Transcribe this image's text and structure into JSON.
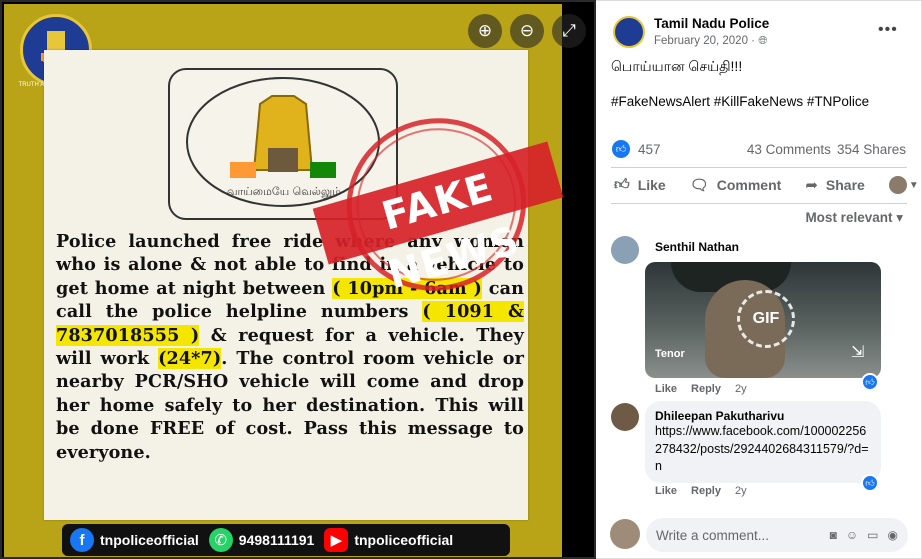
{
  "viewer": {
    "controls": {
      "zoom_in_icon": "🔍︎+",
      "zoom_out_icon": "🔍︎−",
      "expand_icon": "⤢"
    },
    "image": {
      "logo_text": "TAMILNADU POLICE",
      "logo_motto": "TRUTH ALONE TRIUMPHS",
      "emblem_text": "வாய்மையே வெல்லும்",
      "stamp_text": "FAKE NEWS",
      "notice": {
        "p1": "Police launched free ride",
        "p2": "where any women who is alone & not able to find in a vehicle to get home at night between",
        "hl1": "( 10pm - 6am )",
        "p3": "can call the police helpline numbers",
        "hl2": "( 1091 & 7837018555 )",
        "p4": "& request for a vehicle. They will work",
        "hl3": "(24*7)",
        "p5": ". The control room vehicle or nearby PCR/SHO vehicle will come and drop her home safely to her destination. This will be done FREE of cost. Pass this message to everyone."
      },
      "social_bar": {
        "facebook": "tnpoliceofficial",
        "whatsapp": "9498111191",
        "youtube": "tnpoliceofficial"
      }
    }
  },
  "post": {
    "page_name": "Tamil Nadu Police",
    "date": "February 20, 2020 · 🌐︎",
    "more_icon": "•••",
    "text": "பொய்யான செய்தி!!!",
    "hashtags": "#FakeNewsAlert #KillFakeNews #TNPolice",
    "reactions": "457",
    "comments_count": "43 Comments",
    "shares_count": "354 Shares",
    "actions": {
      "like": "Like",
      "comment": "Comment",
      "share": "Share"
    },
    "sort_label": "Most relevant ▾",
    "comments": [
      {
        "name": "Senthil Nathan",
        "gif_label": "GIF",
        "gif_source": "Tenor",
        "like": "Like",
        "reply": "Reply",
        "time": "2y"
      },
      {
        "name": "Dhileepan Pakutharivu",
        "text": "https://www.facebook.com/100002256278432/posts/2924402684311579/?d=n",
        "like": "Like",
        "reply": "Reply",
        "time": "2y"
      }
    ],
    "write_placeholder": "Write a comment..."
  },
  "colors": {
    "facebook_blue": "#1877f2",
    "highlight_yellow": "#f5e600",
    "stamp_red": "#d62228"
  }
}
